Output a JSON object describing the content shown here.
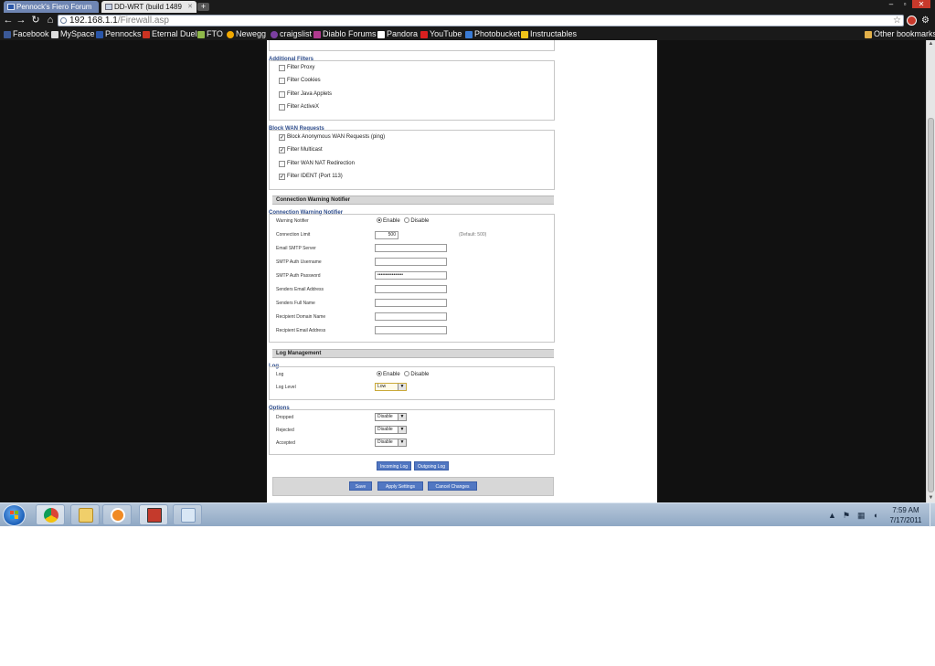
{
  "browser": {
    "tabs": [
      {
        "title": "Pennock's Fiero Forum",
        "active": false
      },
      {
        "title": "DD-WRT (build 1489",
        "active": true
      }
    ],
    "new_tab": "+",
    "window_controls": {
      "minimize": "–",
      "maximize": "▫",
      "close": "✕"
    },
    "url_host": "192.168.1.1",
    "url_path": "/Firewall.asp",
    "bookmarks": [
      "Facebook",
      "MySpace",
      "Pennocks",
      "Eternal Duel",
      "FTO",
      "Newegg",
      "craigslist",
      "Diablo Forums",
      "Pandora",
      "YouTube",
      "Photobucket",
      "Instructables"
    ],
    "other_bookmarks": "Other bookmarks"
  },
  "page": {
    "additional_filters": {
      "legend": "Additional Filters",
      "items": [
        {
          "label": "Filter Proxy",
          "checked": false
        },
        {
          "label": "Filter Cookies",
          "checked": false
        },
        {
          "label": "Filter Java Applets",
          "checked": false
        },
        {
          "label": "Filter ActiveX",
          "checked": false
        }
      ]
    },
    "block_wan": {
      "legend": "Block WAN Requests",
      "items": [
        {
          "label": "Block Anonymous WAN Requests (ping)",
          "checked": true
        },
        {
          "label": "Filter Multicast",
          "checked": true
        },
        {
          "label": "Filter WAN NAT Redirection",
          "checked": false
        },
        {
          "label": "Filter IDENT (Port 113)",
          "checked": true
        }
      ]
    },
    "connection_warning": {
      "section_title": "Connection Warning Notifier",
      "legend": "Connection Warning Notifier",
      "warning_notifier_label": "Warning Notifier",
      "enable": "Enable",
      "disable": "Disable",
      "connection_limit_label": "Connection Limit",
      "connection_limit_value": "500",
      "connection_limit_hint": "(Default: 500)",
      "fields": [
        {
          "label": "Email SMTP Server",
          "value": ""
        },
        {
          "label": "SMTP Auth Username",
          "value": ""
        },
        {
          "label": "SMTP Auth Password",
          "value": "••••••••••••••••"
        },
        {
          "label": "Senders Email Address",
          "value": ""
        },
        {
          "label": "Senders Full Name",
          "value": ""
        },
        {
          "label": "Recipient Domain Name",
          "value": ""
        },
        {
          "label": "Recipient Email Address",
          "value": ""
        }
      ]
    },
    "log_management": {
      "section_title": "Log Management",
      "log_legend": "Log",
      "log_label": "Log",
      "enable": "Enable",
      "disable": "Disable",
      "log_level_label": "Log Level",
      "log_level_value": "Low",
      "options_legend": "Options",
      "options": [
        {
          "label": "Dropped",
          "value": "Disable"
        },
        {
          "label": "Rejected",
          "value": "Disable"
        },
        {
          "label": "Accepted",
          "value": "Disable"
        }
      ],
      "incoming_log": "Incoming Log",
      "outgoing_log": "Outgoing Log"
    },
    "footer": {
      "save": "Save",
      "apply": "Apply Settings",
      "cancel": "Cancel Changes"
    }
  },
  "taskbar": {
    "time": "7:59 AM",
    "date": "7/17/2011",
    "apps": [
      "chrome-icon",
      "folder-icon",
      "media-player-icon",
      "calculator-icon",
      "paint-icon"
    ],
    "tray_icons": [
      "show-hidden-icons",
      "action-center-flag-icon",
      "network-icon",
      "volume-icon"
    ]
  }
}
